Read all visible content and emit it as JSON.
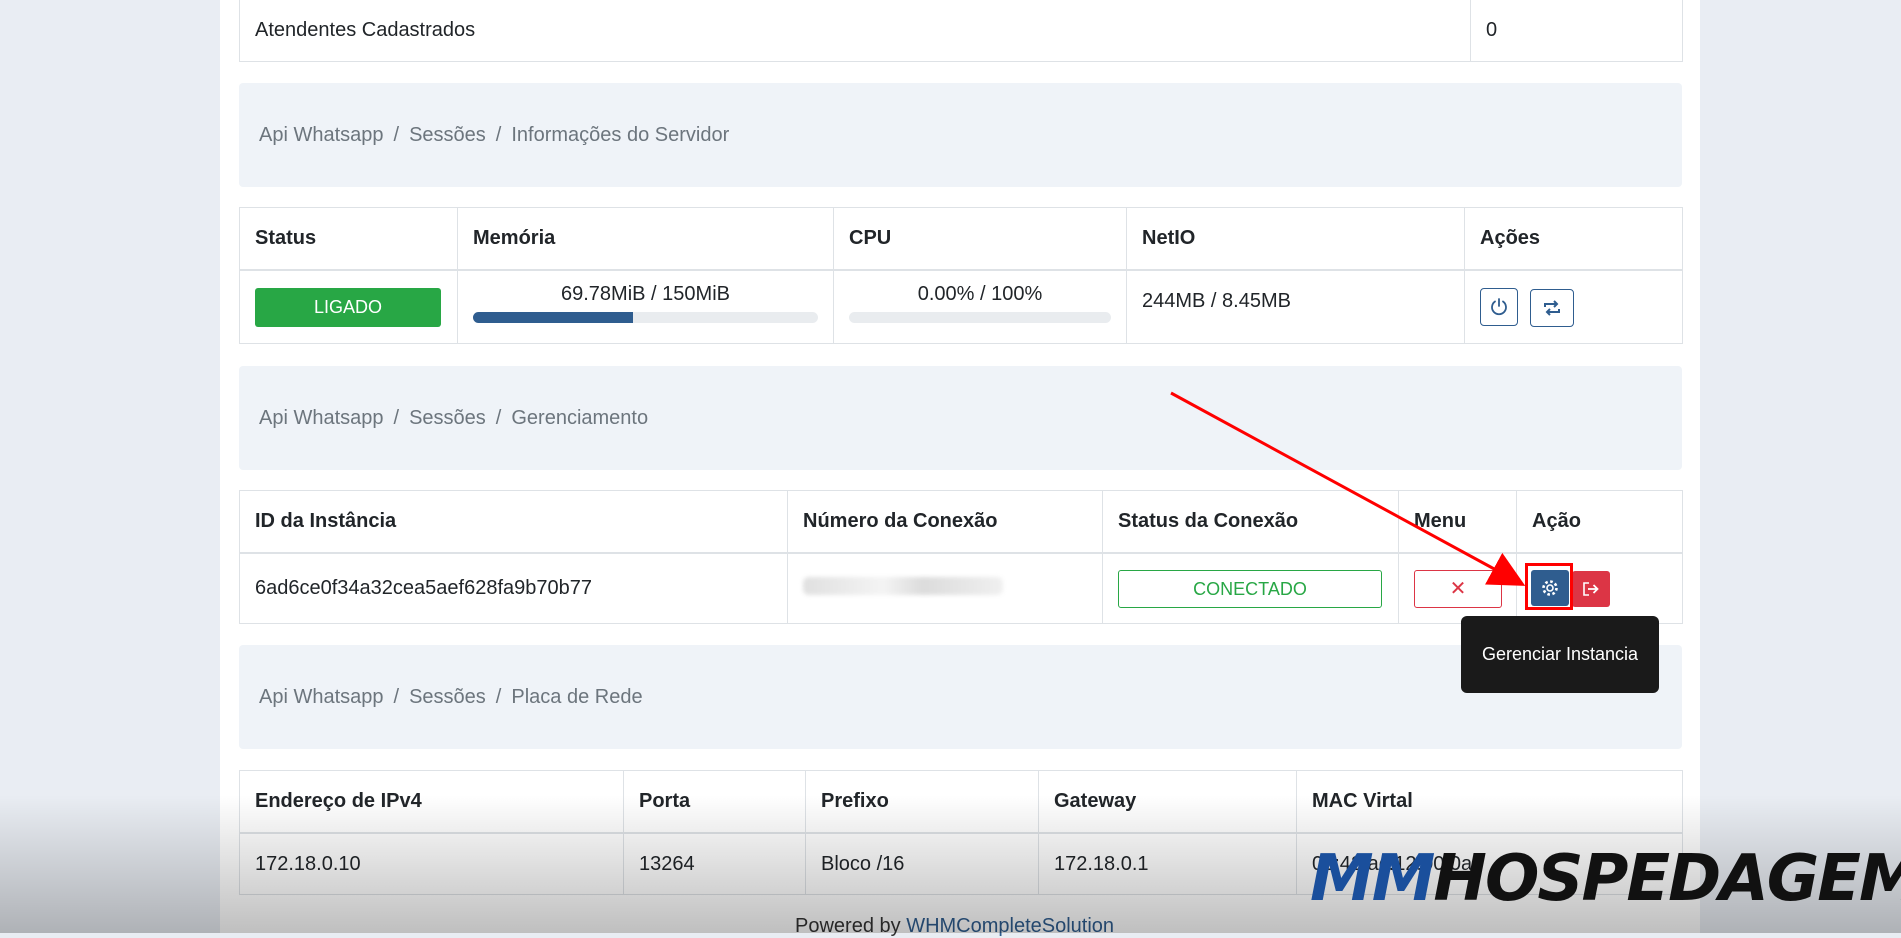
{
  "top_table": {
    "label": "Atendentes Cadastrados",
    "value": "0"
  },
  "crumb_server": {
    "root": "Api Whatsapp",
    "section": "Sessões",
    "current": "Informações do Servidor"
  },
  "server_table": {
    "headers": [
      "Status",
      "Memória",
      "CPU",
      "NetIO",
      "Ações"
    ],
    "status": "LIGADO",
    "memory": {
      "label": "69.78MiB / 150MiB",
      "fraction": 0.465
    },
    "cpu": {
      "label": "0.00% / 100%",
      "fraction": 0.0
    },
    "netio": "244MB / 8.45MB",
    "actions": [
      "power-icon",
      "restart-icon"
    ]
  },
  "crumb_manage": {
    "root": "Api Whatsapp",
    "section": "Sessões",
    "current": "Gerenciamento"
  },
  "instance_table": {
    "headers": [
      "ID da Instância",
      "Número da Conexão",
      "Status da Conexão",
      "Menu",
      "Ação"
    ],
    "instance_id": "6ad6ce0f34a32cea5aef628fa9b70b77",
    "connection_status": "CONECTADO",
    "menu_label": "✕",
    "tooltip": "Gerenciar Instancia"
  },
  "crumb_network": {
    "root": "Api Whatsapp",
    "section": "Sessões",
    "current": "Placa de Rede"
  },
  "network_table": {
    "headers": [
      "Endereço de IPv4",
      "Porta",
      "Prefixo",
      "Gateway",
      "MAC Virtal"
    ],
    "row": [
      "172.18.0.10",
      "13264",
      "Bloco /16",
      "172.18.0.1",
      "02:42:ac:12:00:0a"
    ]
  },
  "footer": {
    "prefix": "Powered by",
    "link": "WHMCompleteSolution"
  },
  "watermark": {
    "part1": "MM",
    "part2": "HOSPEDAGEM"
  },
  "colors": {
    "primary": "#2f5d8f",
    "success": "#28a745",
    "danger": "#dc3545",
    "annotation": "#ff0000"
  }
}
